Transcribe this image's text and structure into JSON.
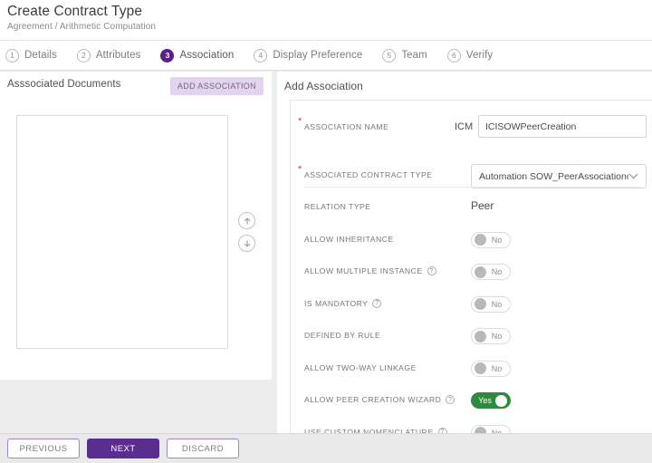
{
  "header": {
    "title": "Create Contract Type",
    "breadcrumb": "Agreement / Arithmetic Computation"
  },
  "stepper": {
    "steps": [
      {
        "num": "1",
        "label": "Details"
      },
      {
        "num": "2",
        "label": "Attributes"
      },
      {
        "num": "3",
        "label": "Association"
      },
      {
        "num": "4",
        "label": "Display Preference"
      },
      {
        "num": "5",
        "label": "Team"
      },
      {
        "num": "6",
        "label": "Verify"
      }
    ],
    "active_index": 2
  },
  "left_panel": {
    "title": "Asssociated Documents",
    "add_association_label": "ADD ASSOCIATION",
    "documents": [],
    "move_up_icon": "arrow-up-circle-icon",
    "move_down_icon": "arrow-down-circle-icon"
  },
  "right_panel": {
    "title": "Add Association",
    "association_name": {
      "label": "ASSOCIATION NAME",
      "prefix": "ICM",
      "value": "ICISOWPeerCreation",
      "placeholder": "",
      "required": true
    },
    "associated_contract_type": {
      "label": "ASSOCIATED CONTRACT TYPE",
      "value": "Automation SOW_PeerAssociationcre...",
      "required": true,
      "chevron_icon": "chevron-down-icon"
    },
    "rows": [
      {
        "label": "RELATION TYPE",
        "type": "text",
        "value": "Peer",
        "help": false
      },
      {
        "label": "ALLOW INHERITANCE",
        "type": "toggle",
        "value": "No",
        "on": false,
        "help": false
      },
      {
        "label": "ALLOW MULTIPLE INSTANCE",
        "type": "toggle",
        "value": "No",
        "on": false,
        "help": true
      },
      {
        "label": "IS MANDATORY",
        "type": "toggle",
        "value": "No",
        "on": false,
        "help": true
      },
      {
        "label": "DEFINED BY RULE",
        "type": "toggle",
        "value": "No",
        "on": false,
        "help": false
      },
      {
        "label": "ALLOW TWO-WAY LINKAGE",
        "type": "toggle",
        "value": "No",
        "on": false,
        "help": false
      },
      {
        "label": "ALLOW PEER CREATION WIZARD",
        "type": "toggle",
        "value": "Yes",
        "on": true,
        "help": true
      },
      {
        "label": "USE CUSTOM NOMENCLATURE",
        "type": "toggle",
        "value": "No",
        "on": false,
        "help": true
      }
    ],
    "help_icon": "question-circle-icon"
  },
  "footer": {
    "previous_label": "PREVIOUS",
    "next_label": "NEXT",
    "discard_label": "DISCARD"
  },
  "colors": {
    "accent": "#5b2d91",
    "active_step": "#5b1e87",
    "add_button_bg": "#e2d4f0",
    "toggle_on": "#2e8b3d",
    "required_star": "#e8332a"
  }
}
